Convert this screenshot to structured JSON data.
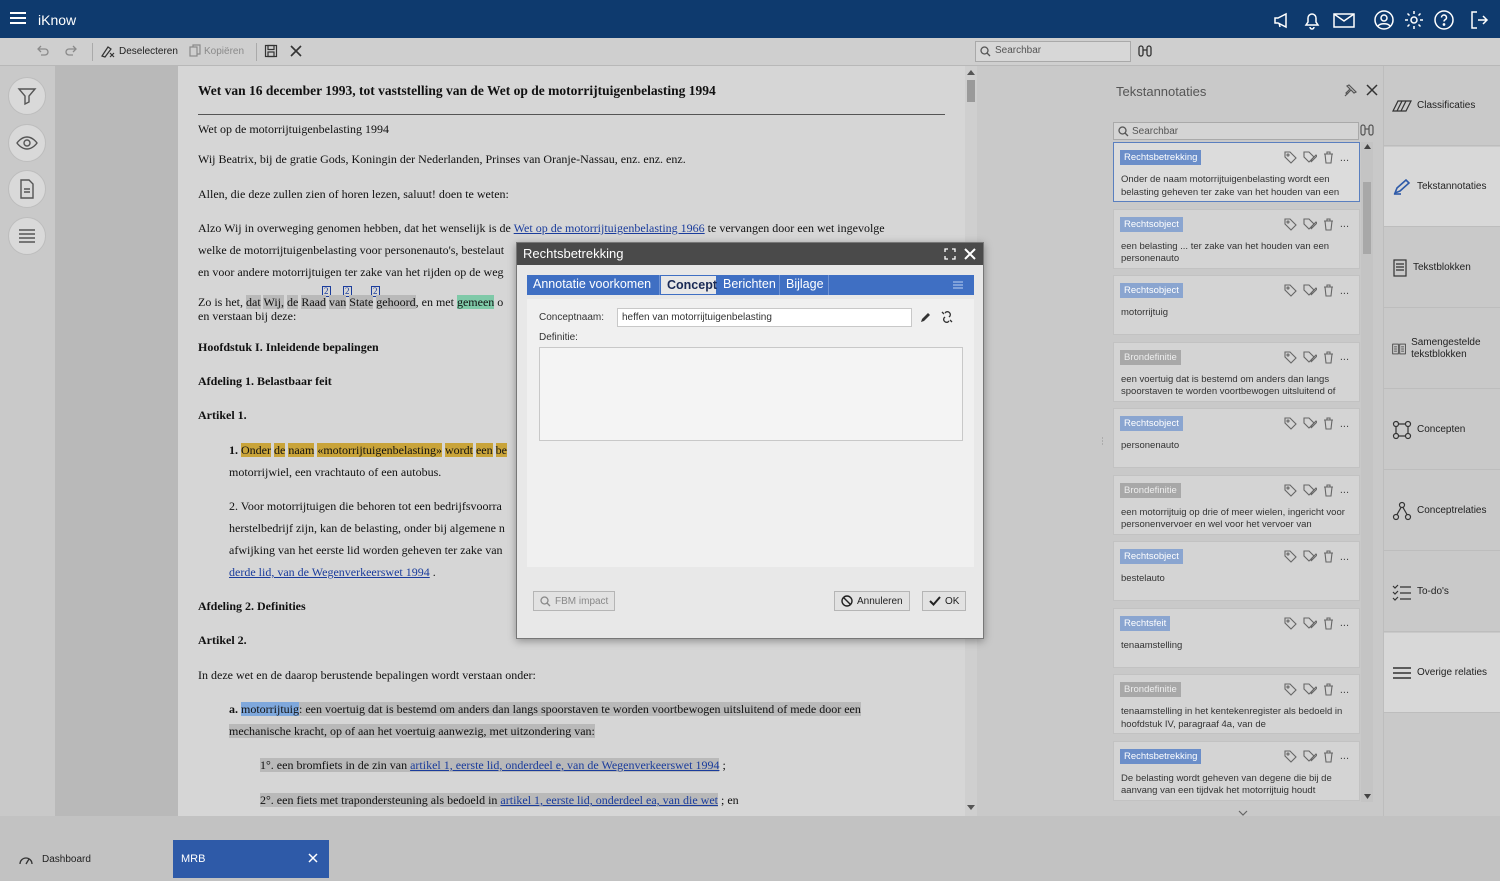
{
  "app": {
    "title": "iKnow"
  },
  "toolbar": {
    "deselect": "Deselecteren",
    "copy": "Kopiëren",
    "search_placeholder": "Searchbar"
  },
  "document": {
    "title": "Wet van 16 december 1993, tot vaststelling van de Wet op de motorrijtuigenbelasting 1994",
    "l1": "Wet op de motorrijtuigenbelasting 1994",
    "l2": "Wij Beatrix, bij de gratie Gods, Koningin der Nederlanden, Prinses van Oranje-Nassau, enz. enz. enz.",
    "l3": "Allen, die deze zullen zien of horen lezen, saluut! doen te weten:",
    "l4a": "Alzo Wij in overweging genomen hebben, dat het wenselijk is de ",
    "l4link": "Wet op de motorrijtuigenbelasting 1966",
    "l4b": " te vervangen door een wet ingevolge",
    "l5": "welke de motorrijtuigenbelasting voor personenauto's, bestelaut",
    "l6": "en voor andere motorrijtuigen ter zake van het rijden op de weg",
    "l7a": "Zo is het, ",
    "l7w": [
      "dat",
      "Wij,",
      "de",
      "Raad",
      "van",
      "State",
      "gehoord"
    ],
    "l7b": ", en met ",
    "l7g": "gemeen",
    "l7c": " o",
    "sup": "2",
    "l8": "en verstaan bij deze:",
    "h1": "Hoofdstuk I. Inleidende bepalingen",
    "h2": "Afdeling 1. Belastbaar feit",
    "h3": "Artikel 1.",
    "a1n": "1. ",
    "a1w": [
      "Onder",
      "de",
      "naam"
    ],
    "a1q": "«motorrijtuigenbelasting»",
    "a1w2": [
      "wordt",
      "een",
      "be"
    ],
    "a1l2": "motorrijwiel, een vrachtauto of een autobus.",
    "a2l1": "2. Voor motorrijtuigen die behoren tot een bedrijfsvoorra",
    "a2l2": "herstelbedrijf zijn, kan de belasting, onder bij algemene n",
    "a2l3": "afwijking van het eerste lid worden geheven ter zake van",
    "a2link": "derde lid, van de Wegenverkeerswet 1994",
    "a2end": " .",
    "h4": "Afdeling 2. Definities",
    "h5": "Artikel 2.",
    "intro": "In deze wet en de daarop berustende bepalingen wordt verstaan onder:",
    "da": "a. ",
    "dterm": "motorrijtuig",
    "dtext1": ": een voertuig dat is bestemd om anders dan langs spoorstaven te worden voortbewogen uitsluitend of mede door een",
    "dtext2": "mechanische kracht, op of aan het voertuig aanwezig, met uitzondering van:",
    "s1a": "1°. een bromfiets in de zin van ",
    "s1link": "artikel 1, eerste lid, onderdeel e, van de Wegenverkeerswet 1994",
    "s1b": " ;",
    "s2a": "2°. een fiets met trapondersteuning als bedoeld in ",
    "s2link": "artikel 1, eerste lid, onderdeel ea, van die wet",
    "s2b": " ; en"
  },
  "dialog": {
    "title": "Rechtsbetrekking",
    "tabs": [
      "Annotatie voorkomen",
      "Concept",
      "Berichten",
      "Bijlage"
    ],
    "concept_label": "Conceptnaam:",
    "concept_value": "heffen van motorrijtuigenbelasting",
    "definition_label": "Definitie:",
    "fbm": "FBM impact",
    "cancel": "Annuleren",
    "ok": "OK"
  },
  "annotations": {
    "title": "Tekstannotaties",
    "search_placeholder": "Searchbar",
    "items": [
      {
        "tag": "Rechtsbetrekking",
        "text": "Onder de naam motorrijtuigenbelasting wordt een belasting geheven ter zake van het houden van een",
        "style": "full",
        "selected": true
      },
      {
        "tag": "Rechtsobject",
        "text": "een belasting ... ter zake van het houden van een personenauto",
        "style": "mid"
      },
      {
        "tag": "Rechtsobject",
        "text": "motorrijtuig",
        "style": "mid"
      },
      {
        "tag": "Brondefinitie",
        "text": "een voertuig dat is bestemd om anders dan langs spoorstaven te worden voortbewogen uitsluitend of",
        "style": "dim"
      },
      {
        "tag": "Rechtsobject",
        "text": "personenauto",
        "style": "mid"
      },
      {
        "tag": "Brondefinitie",
        "text": "een motorrijtuig op drie of meer wielen, ingericht voor personenvervoer en wel voor het vervoer van",
        "style": "dim"
      },
      {
        "tag": "Rechtsobject",
        "text": "bestelauto",
        "style": "mid"
      },
      {
        "tag": "Rechtsfeit",
        "text": "tenaamstelling",
        "style": "mid"
      },
      {
        "tag": "Brondefinitie",
        "text": "tenaamstelling in het kentekenregister als bedoeld in hoofdstuk IV, paragraaf 4a, van de",
        "style": "dim"
      },
      {
        "tag": "Rechtsbetrekking",
        "text": "De belasting wordt geheven van degene die bij de aanvang van een tijdvak het motorrijtuig houdt",
        "style": "full"
      }
    ],
    "more": "..."
  },
  "sidenav": [
    {
      "label": "Classificaties",
      "icon": "classification-icon"
    },
    {
      "label": "Tekstannotaties",
      "icon": "annotation-pen-icon"
    },
    {
      "label": "Tekstblokken",
      "icon": "textblock-icon"
    },
    {
      "label": "Samengestelde tekstblokken",
      "icon": "composite-textblock-icon"
    },
    {
      "label": "Concepten",
      "icon": "concepts-icon"
    },
    {
      "label": "Conceptrelaties",
      "icon": "concept-relations-icon"
    },
    {
      "label": "To-do's",
      "icon": "todo-icon"
    },
    {
      "label": "Overige relaties",
      "icon": "other-relations-icon"
    }
  ],
  "tabs": {
    "dashboard": "Dashboard",
    "mrb": "MRB"
  },
  "colors": {
    "header": "#0e3a6e",
    "tab_active": "#2e5aa8",
    "dialog_tabs": "#3f6fc3",
    "highlight_gold": "#c9a43a"
  }
}
